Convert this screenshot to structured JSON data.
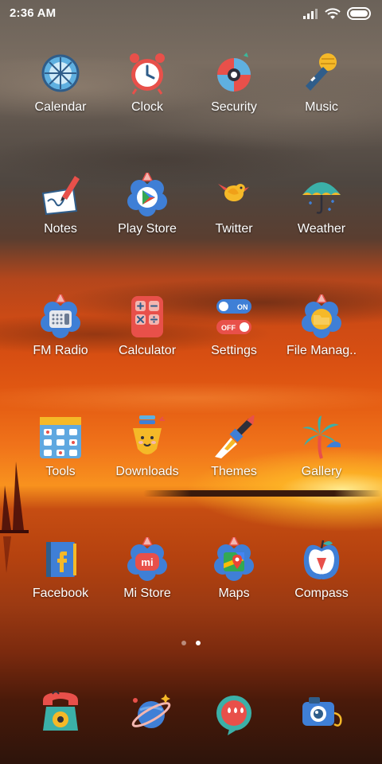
{
  "status_bar": {
    "time": "2:36 AM",
    "icons": [
      "signal-icon",
      "wifi-icon",
      "battery-icon"
    ]
  },
  "apps": [
    {
      "label": "Calendar",
      "icon": "calendar-icon"
    },
    {
      "label": "Clock",
      "icon": "alarm-clock-icon"
    },
    {
      "label": "Security",
      "icon": "security-shield-icon"
    },
    {
      "label": "Music",
      "icon": "microphone-icon"
    },
    {
      "label": "Notes",
      "icon": "notes-pencil-icon"
    },
    {
      "label": "Play Store",
      "icon": "play-store-icon"
    },
    {
      "label": "Twitter",
      "icon": "bird-icon"
    },
    {
      "label": "Weather",
      "icon": "umbrella-icon"
    },
    {
      "label": "FM Radio",
      "icon": "radio-icon"
    },
    {
      "label": "Calculator",
      "icon": "calculator-icon"
    },
    {
      "label": "Settings",
      "icon": "toggle-switches-icon"
    },
    {
      "label": "File Manag..",
      "icon": "folder-icon"
    },
    {
      "label": "Tools",
      "icon": "tools-grid-icon"
    },
    {
      "label": "Downloads",
      "icon": "download-face-icon"
    },
    {
      "label": "Themes",
      "icon": "paintbrush-icon"
    },
    {
      "label": "Gallery",
      "icon": "palm-tree-icon"
    },
    {
      "label": "Facebook",
      "icon": "facebook-book-icon"
    },
    {
      "label": "Mi Store",
      "icon": "mi-store-icon"
    },
    {
      "label": "Maps",
      "icon": "maps-pin-icon"
    },
    {
      "label": "Compass",
      "icon": "apple-compass-icon"
    }
  ],
  "page_indicator": {
    "count": 2,
    "active": 1
  },
  "dock": [
    {
      "icon": "phone-icon"
    },
    {
      "icon": "planet-icon"
    },
    {
      "icon": "water-drops-icon"
    },
    {
      "icon": "camera-icon"
    }
  ],
  "colors": {
    "accent_red": "#e8504a",
    "icon_blue": "#3f7fd6",
    "icon_yellow": "#f5b928",
    "text": "#ffffff"
  }
}
